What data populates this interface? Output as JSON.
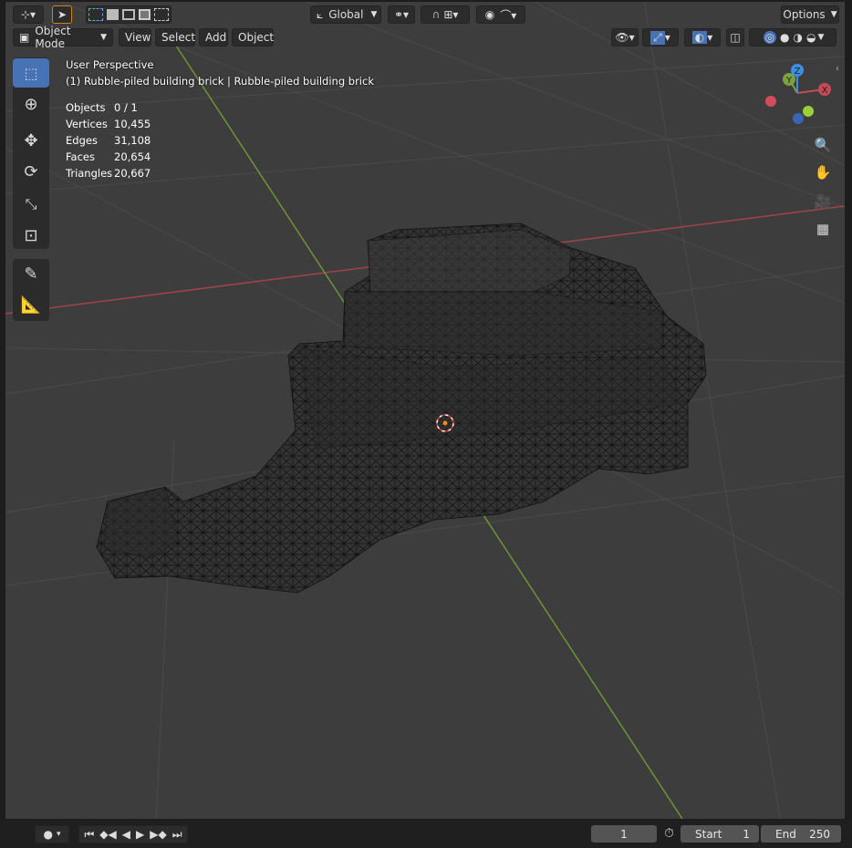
{
  "header": {
    "transform_orientation": "Global",
    "options_label": "Options",
    "mode_label": "Object Mode",
    "menus": [
      "View",
      "Select",
      "Add",
      "Object"
    ]
  },
  "overlay_text": {
    "perspective": "User Perspective",
    "object_name": "(1) Rubble-piled building brick | Rubble-piled building brick",
    "stats": [
      {
        "label": "Objects",
        "value": "0 / 1"
      },
      {
        "label": "Vertices",
        "value": "10,455"
      },
      {
        "label": "Edges",
        "value": "31,108"
      },
      {
        "label": "Faces",
        "value": "20,654"
      },
      {
        "label": "Triangles",
        "value": "20,667"
      }
    ]
  },
  "gizmo": {
    "x": "X",
    "y": "Y",
    "z": "Z"
  },
  "timeline": {
    "current_frame": "1",
    "start_label": "Start",
    "start_value": "1",
    "end_label": "End",
    "end_value": "250"
  },
  "colors": {
    "viewport_bg": "#3d3d3d",
    "active_blue": "#4772b3",
    "x_axis": "#c64a55",
    "y_axis": "#7aa33d",
    "z_axis": "#3a8ee6"
  }
}
